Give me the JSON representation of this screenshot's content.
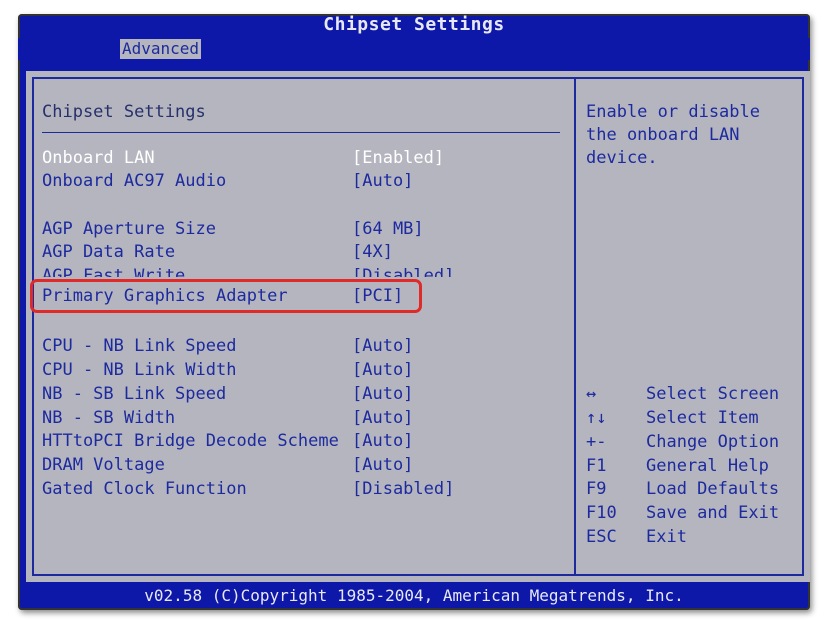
{
  "window": {
    "title": "Chipset Settings"
  },
  "tabs": [
    {
      "label": "Advanced"
    }
  ],
  "panel": {
    "title": "Chipset Settings"
  },
  "items": [
    {
      "label": "Onboard LAN",
      "value": "[Enabled]"
    },
    {
      "label": "Onboard AC97 Audio",
      "value": "[Auto]"
    },
    {
      "label": "AGP Aperture Size",
      "value": "[64 MB]"
    },
    {
      "label": "AGP Data Rate",
      "value": "[4X]"
    },
    {
      "label": "AGP Fast Write",
      "value": "[Disabled]"
    },
    {
      "label": "Primary Graphics Adapter",
      "value": "[PCI]"
    },
    {
      "label": "CPU - NB Link Speed",
      "value": "[Auto]"
    },
    {
      "label": "CPU - NB Link Width",
      "value": "[Auto]"
    },
    {
      "label": "NB - SB Link Speed",
      "value": "[Auto]"
    },
    {
      "label": "NB - SB Width",
      "value": "[Auto]"
    },
    {
      "label": "HTTtoPCI Bridge Decode Scheme",
      "value": "[Auto]"
    },
    {
      "label": "DRAM Voltage",
      "value": "[Auto]"
    },
    {
      "label": "Gated Clock Function",
      "value": "[Disabled]"
    }
  ],
  "help": {
    "text": "Enable or disable the onboard LAN device."
  },
  "keys": [
    {
      "key": "↔",
      "desc": "Select Screen"
    },
    {
      "key": "↑↓",
      "desc": "Select Item"
    },
    {
      "key": "+-",
      "desc": "Change Option"
    },
    {
      "key": "F1",
      "desc": "General Help"
    },
    {
      "key": "F9",
      "desc": "Load Defaults"
    },
    {
      "key": "F10",
      "desc": "Save and Exit"
    },
    {
      "key": "ESC",
      "desc": "Exit"
    }
  ],
  "footer": {
    "text": "v02.58 (C)Copyright 1985-2004, American Megatrends, Inc."
  },
  "colors": {
    "background": "#0d17a8",
    "panel": "#b5b5c0",
    "text": "#1c2a9e",
    "selected_text": "#ffffff",
    "highlight_outline": "#e02a2a"
  }
}
